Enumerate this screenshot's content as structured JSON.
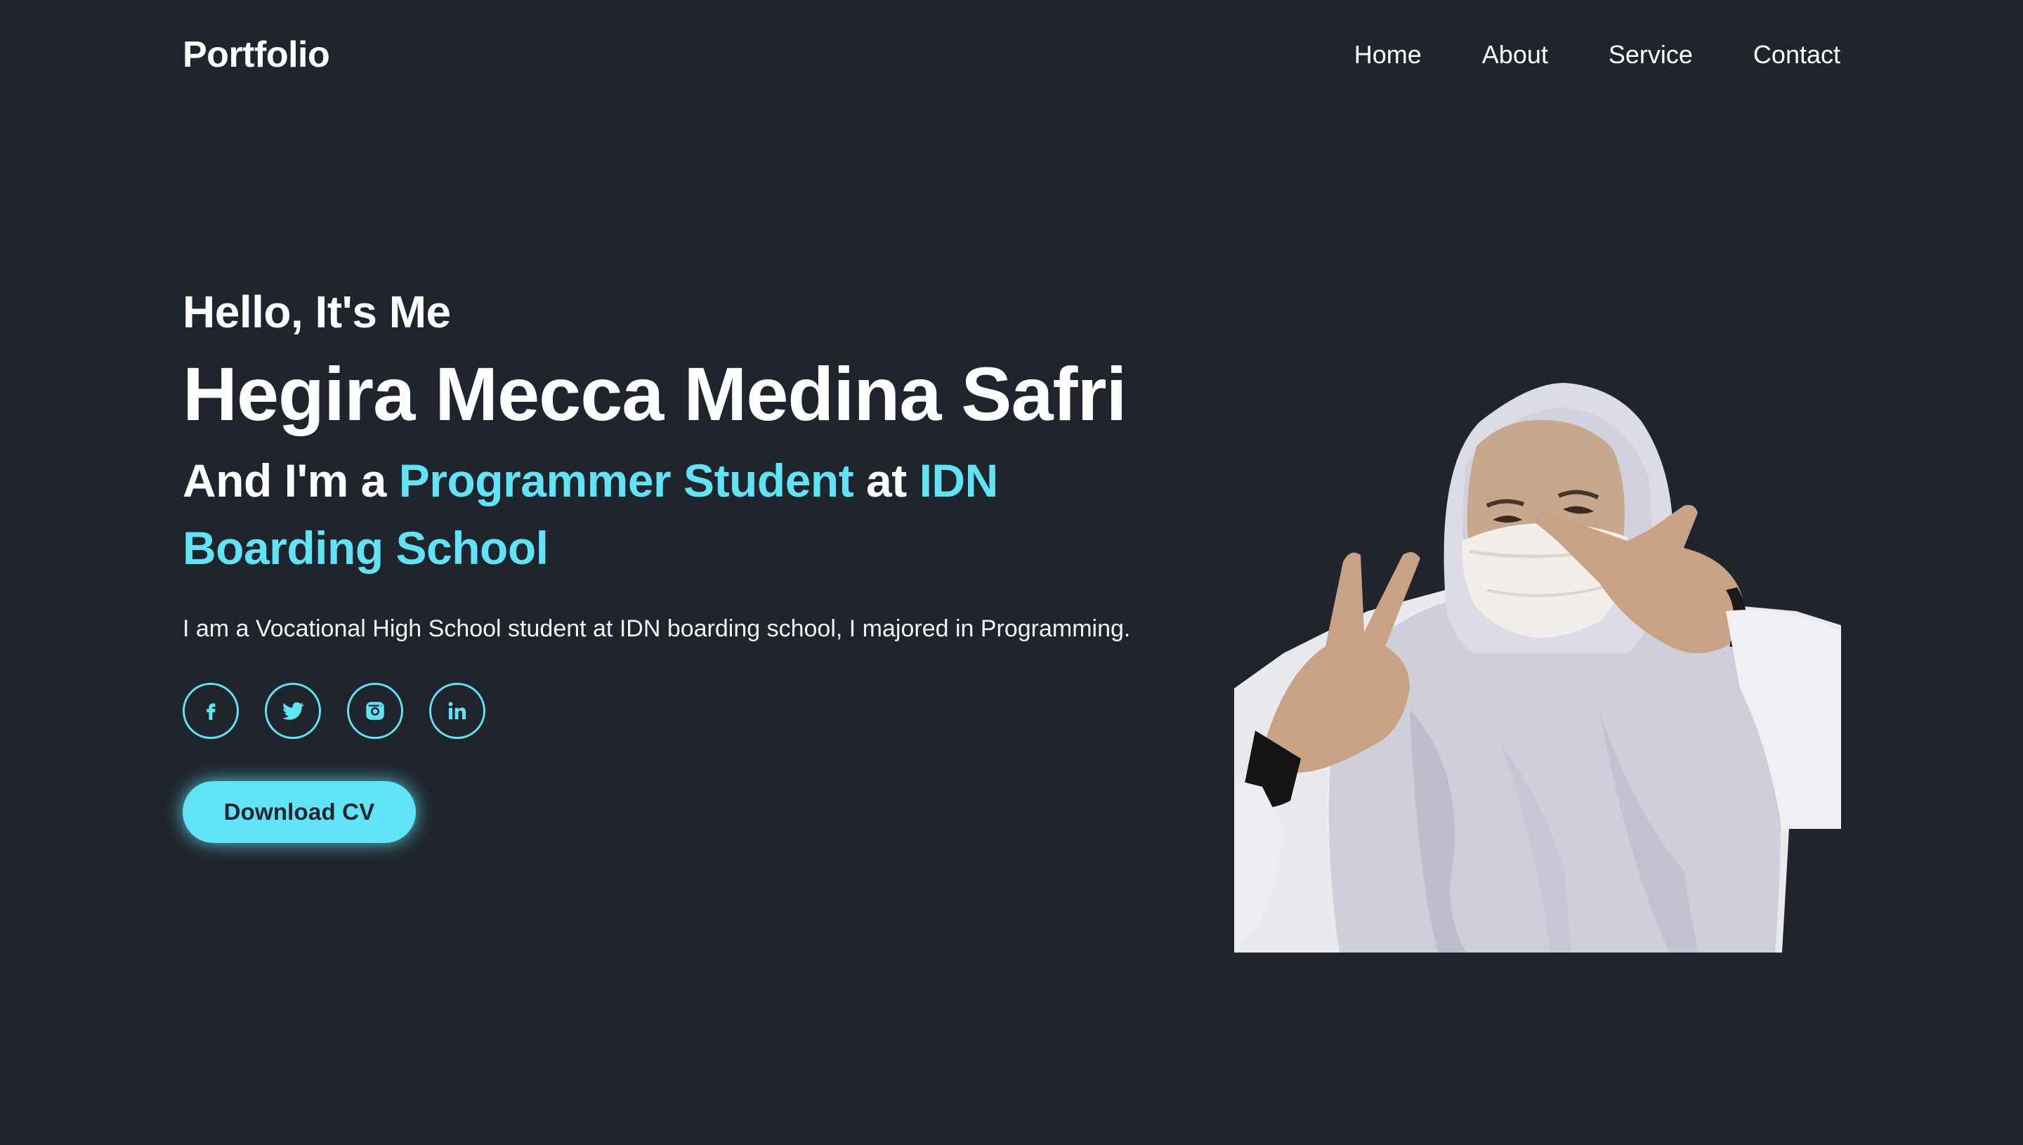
{
  "header": {
    "logo": "Portfolio",
    "nav": [
      {
        "label": "Home"
      },
      {
        "label": "About"
      },
      {
        "label": "Service"
      },
      {
        "label": "Contact"
      }
    ]
  },
  "hero": {
    "greeting": "Hello, It's Me",
    "name": "Hegira Mecca Medina Safri",
    "role_prefix": "And I'm a ",
    "role_highlight": "Programmer Student",
    "role_middle": " at ",
    "role_school": "IDN Boarding School",
    "description": "I am a Vocational High School student at IDN boarding school, I majored in Programming.",
    "socials": [
      {
        "icon": "facebook-icon"
      },
      {
        "icon": "twitter-icon"
      },
      {
        "icon": "instagram-icon"
      },
      {
        "icon": "linkedin-icon"
      }
    ],
    "cta_label": "Download CV"
  },
  "colors": {
    "background": "#1f242d",
    "accent": "#5fe3f5",
    "text": "#ffffff"
  }
}
